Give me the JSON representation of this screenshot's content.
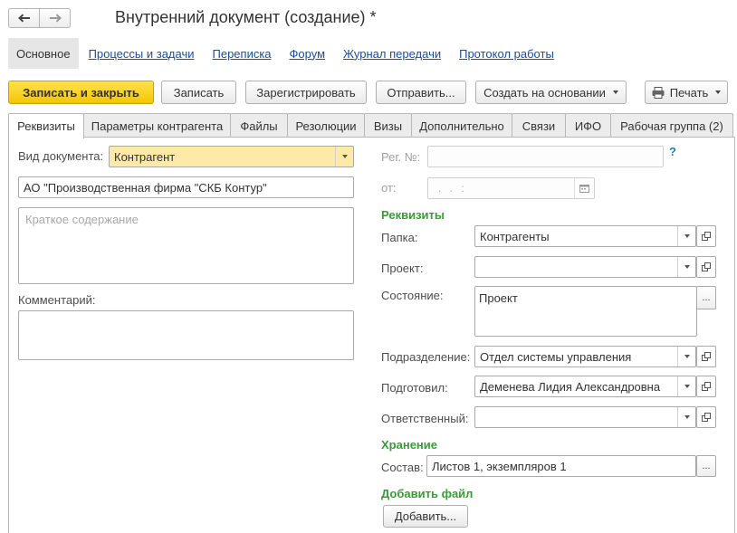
{
  "window": {
    "title": "Внутренний документ (создание) *",
    "back_icon": "arrow-left-icon",
    "forward_icon": "arrow-right-icon"
  },
  "topnav": {
    "active": "Основное",
    "links": [
      "Процессы и задачи",
      "Переписка",
      "Форум",
      "Журнал передачи",
      "Протокол работы"
    ]
  },
  "toolbar": {
    "save_close": "Записать и закрыть",
    "save": "Записать",
    "register": "Зарегистрировать",
    "send": "Отправить...",
    "create_based": "Создать на основании",
    "print": "Печать"
  },
  "tabs": [
    "Реквизиты",
    "Параметры контрагента",
    "Файлы",
    "Резолюции",
    "Визы",
    "Дополнительно",
    "Связи",
    "ИФО",
    "Рабочая группа (2)"
  ],
  "left": {
    "doc_type_label": "Вид документа:",
    "doc_type_value": "Контрагент",
    "counterparty_value": "АО \"Производственная фирма \"СКБ Контур\"",
    "summary_placeholder": "Краткое содержание",
    "comment_label": "Комментарий:"
  },
  "right": {
    "reg_no_label": "Рег. №:",
    "reg_no_value": "",
    "help": "?",
    "date_label": "от:",
    "date_mask": ".  .       :",
    "requisites_title": "Реквизиты",
    "folder_label": "Папка:",
    "folder_value": "Контрагенты",
    "project_label": "Проект:",
    "project_value": "",
    "state_label": "Состояние:",
    "state_value": "Проект",
    "department_label": "Подразделение:",
    "department_value": "Отдел системы управления",
    "prepared_label": "Подготовил:",
    "prepared_value": "Деменева Лидия Александровна",
    "responsible_label": "Ответственный:",
    "responsible_value": "",
    "storage_title": "Хранение",
    "composition_label": "Состав:",
    "composition_value": "Листов 1, экземпляров 1",
    "add_file_title": "Добавить файл",
    "add_button": "Добавить..."
  },
  "dots": "...",
  "colors": {
    "primary_button": "#f4c500",
    "section_title": "#3a9a3a",
    "link": "#1a4d99",
    "highlight_field": "#fde9a8"
  }
}
